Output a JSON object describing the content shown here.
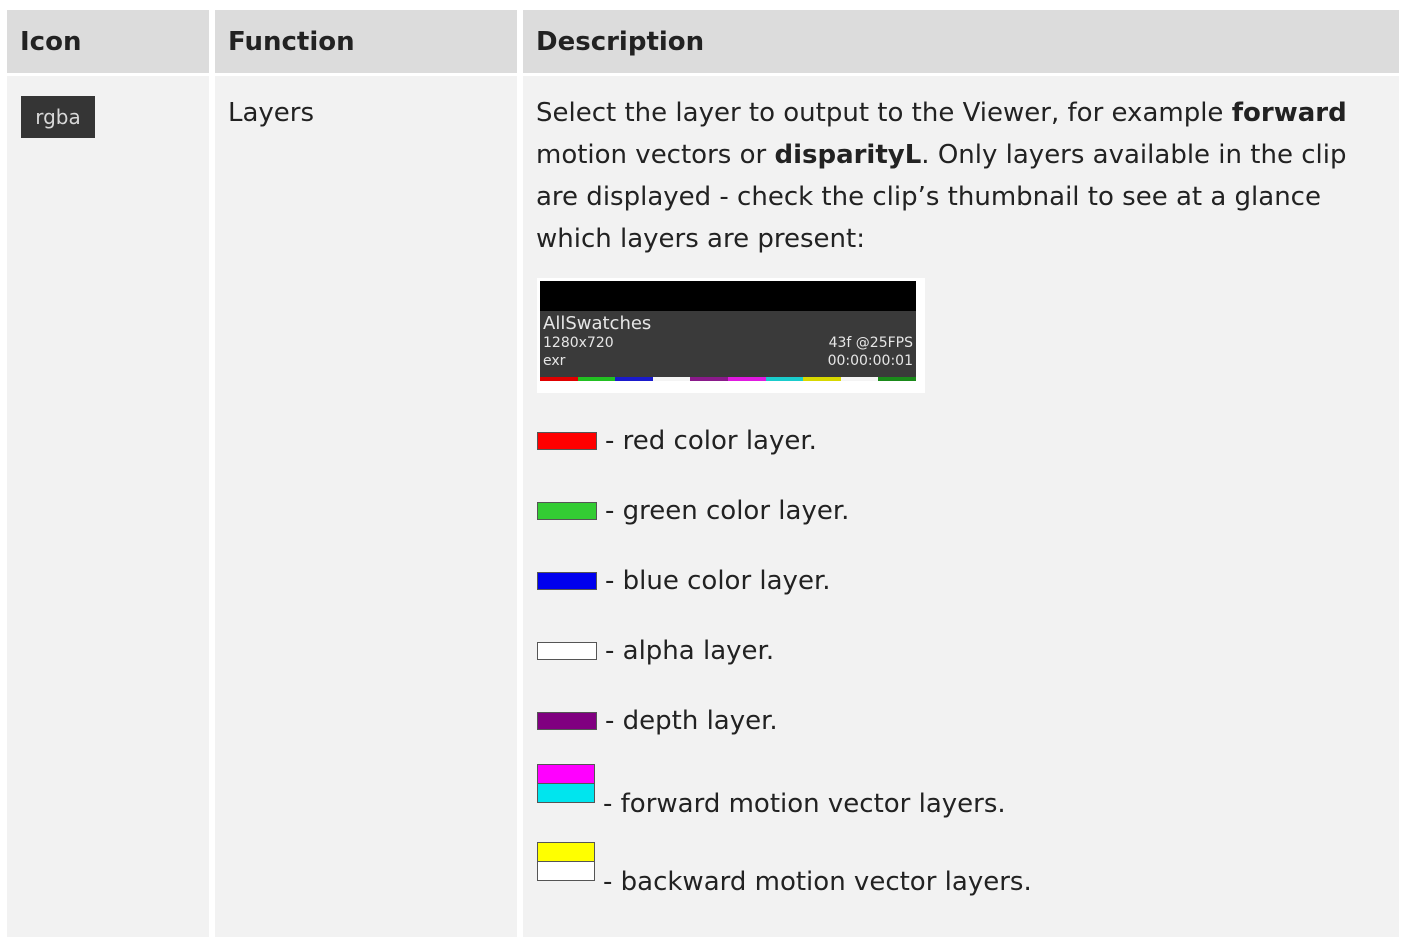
{
  "headers": {
    "icon": "Icon",
    "function": "Function",
    "description": "Description"
  },
  "row": {
    "icon_label": "rgba",
    "function": "Layers",
    "desc": {
      "part1": "Select the layer to output to the Viewer, for example ",
      "bold1": "forward",
      "part2": " motion vectors or ",
      "bold2": "disparityL",
      "part3": ". Only layers available in the clip are displayed - check the clip’s thumbnail to see at a glance which layers are present:"
    },
    "thumbnail": {
      "name": "AllSwatches",
      "resolution": "1280x720",
      "format": "exr",
      "frames": "43f @25FPS",
      "timecode": "00:00:00:01",
      "bar_colors": [
        "#e00000",
        "#22c022",
        "#1a1acc",
        "#f4f4f4",
        "#8a1a8a",
        "#e01ae0",
        "#1acccc",
        "#d8d800",
        "#f4f4f4",
        "#1a8a1a"
      ]
    },
    "layers": [
      {
        "text": "- red color layer.",
        "colors": [
          "#ff0000"
        ]
      },
      {
        "text": "- green color layer.",
        "colors": [
          "#33cc33"
        ]
      },
      {
        "text": "- blue color layer.",
        "colors": [
          "#0000ee"
        ]
      },
      {
        "text": "- alpha layer.",
        "colors": [
          "#ffffff"
        ]
      },
      {
        "text": "- depth layer.",
        "colors": [
          "#800080"
        ]
      },
      {
        "text": "- forward motion vector layers.",
        "colors": [
          "#ff00ff",
          "#00e5ee"
        ]
      },
      {
        "text": "- backward motion vector layers.",
        "colors": [
          "#ffff00",
          "#ffffff"
        ]
      }
    ]
  }
}
